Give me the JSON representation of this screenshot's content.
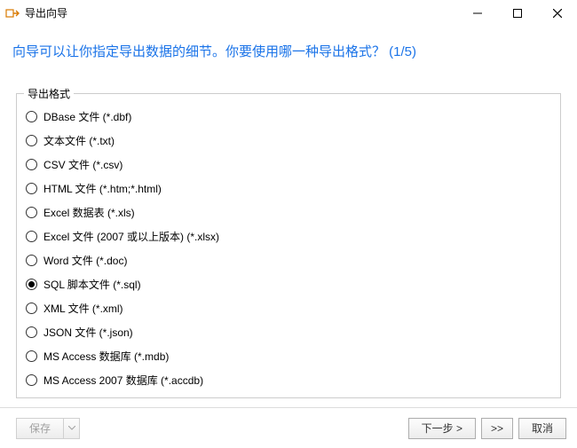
{
  "window": {
    "title": "导出向导"
  },
  "header": {
    "text": "向导可以让你指定导出数据的细节。你要使用哪一种导出格式？ (1/5)"
  },
  "fieldset": {
    "legend": "导出格式"
  },
  "formats": [
    {
      "label": "DBase 文件 (*.dbf)",
      "selected": false
    },
    {
      "label": "文本文件 (*.txt)",
      "selected": false
    },
    {
      "label": "CSV 文件 (*.csv)",
      "selected": false
    },
    {
      "label": "HTML 文件 (*.htm;*.html)",
      "selected": false
    },
    {
      "label": "Excel 数据表 (*.xls)",
      "selected": false
    },
    {
      "label": "Excel 文件 (2007 或以上版本) (*.xlsx)",
      "selected": false
    },
    {
      "label": "Word 文件 (*.doc)",
      "selected": false
    },
    {
      "label": "SQL 脚本文件 (*.sql)",
      "selected": true
    },
    {
      "label": "XML 文件 (*.xml)",
      "selected": false
    },
    {
      "label": "JSON 文件 (*.json)",
      "selected": false
    },
    {
      "label": "MS Access 数据库 (*.mdb)",
      "selected": false
    },
    {
      "label": "MS Access 2007 数据库 (*.accdb)",
      "selected": false
    }
  ],
  "buttons": {
    "save": "保存",
    "next": "下一步 >",
    "last": ">>",
    "cancel": "取消"
  }
}
